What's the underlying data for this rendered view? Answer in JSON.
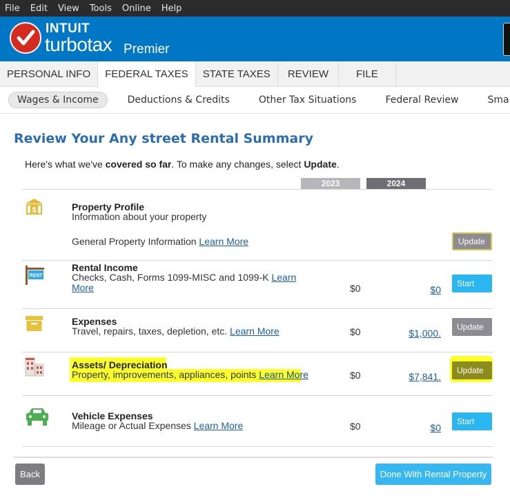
{
  "menubar": {
    "items": [
      "File",
      "Edit",
      "View",
      "Tools",
      "Online",
      "Help"
    ]
  },
  "brand": {
    "intuit": "INTUIT",
    "turbotax": "turbotax",
    "edition": "Premier"
  },
  "maintabs": [
    "PERSONAL INFO",
    "FEDERAL TAXES",
    "STATE TAXES",
    "REVIEW",
    "FILE"
  ],
  "subnav": [
    "Wages & Income",
    "Deductions & Credits",
    "Other Tax Situations",
    "Federal Review",
    "Smart Check"
  ],
  "page": {
    "title": "Review Your Any street Rental Summary",
    "intro_a": "Here's what we've ",
    "intro_b": "covered so far",
    "intro_c": ". To make any changes, select ",
    "intro_d": "Update",
    "intro_e": "."
  },
  "years": [
    "2023",
    "2024"
  ],
  "rows": {
    "profile": {
      "title": "Property Profile",
      "desc": "Information about your property",
      "general": "General Property Information",
      "learn": "Learn More",
      "button": "Update"
    },
    "income": {
      "title": "Rental Income",
      "desc_a": "Checks, Cash, Forms 1099-MISC and 1099-K",
      "learn_a": "Learn",
      "learn_b": "More",
      "y2023": "$0",
      "y2024": "$0",
      "button": "Start"
    },
    "expenses": {
      "title": "Expenses",
      "desc": "Travel, repairs, taxes, depletion, etc.",
      "learn": "Learn More",
      "y2023": "$0",
      "y2024": "$1,000.",
      "button": "Update"
    },
    "assets": {
      "title": "Assets/ Depreciation",
      "desc": "Property, improvements, appliances, points",
      "learn": "Learn More",
      "y2023": "$0",
      "y2024": "$7,841.",
      "button": "Update"
    },
    "vehicle": {
      "title": "Vehicle Expenses",
      "desc": "Mileage or Actual Expenses",
      "learn": "Learn More",
      "y2023": "$0",
      "y2024": "$0",
      "button": "Start"
    }
  },
  "footer": {
    "back": "Back",
    "done": "Done With Rental Property"
  },
  "colors": {
    "brand_blue": "#0077c5",
    "title_blue": "#2a6db3",
    "start_blue": "#29b6f1",
    "highlight": "#fbff2a"
  }
}
